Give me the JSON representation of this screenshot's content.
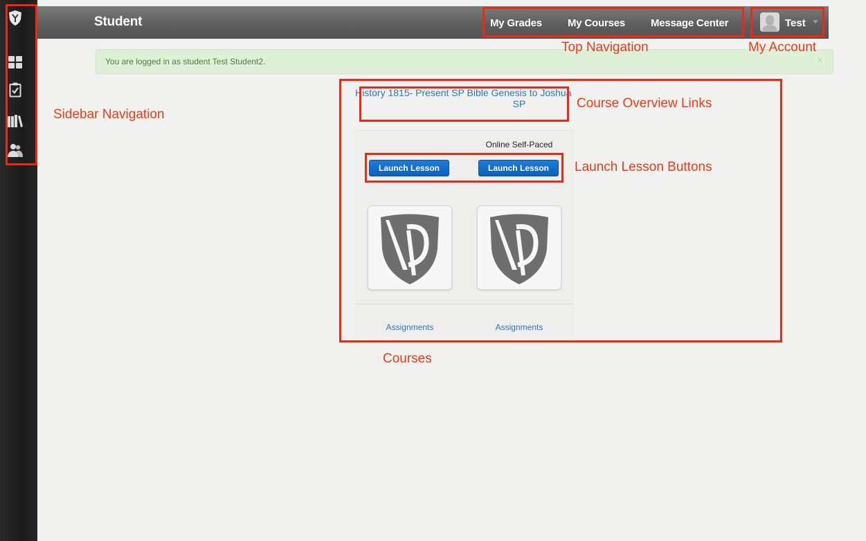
{
  "header": {
    "brand": "Student",
    "nav": [
      {
        "label": "My Grades"
      },
      {
        "label": "My Courses"
      },
      {
        "label": "Message Center"
      }
    ],
    "user": {
      "name": "Test"
    }
  },
  "sidebar": {
    "icons": [
      "school-crest-icon",
      "dashboard-icon",
      "checklist-icon",
      "books-icon",
      "people-icon"
    ]
  },
  "alert": {
    "message": "You are logged in as student Test Student2.",
    "close": "×"
  },
  "courses": [
    {
      "title": "History 1815- Present SP",
      "type": "",
      "launch": "Launch Lesson",
      "assignments": "Assignments"
    },
    {
      "title": "Bible Genesis to Joshua SP",
      "type": "Online Self-Paced",
      "launch": "Launch Lesson",
      "assignments": "Assignments"
    }
  ],
  "annotations": {
    "top_navigation": "Top Navigation",
    "my_account": "My Account",
    "sidebar_navigation": "Sidebar Navigation",
    "course_overview_links": "Course Overview Links",
    "launch_lesson_buttons": "Launch Lesson Buttons",
    "courses": "Courses"
  },
  "colors": {
    "annotation": "#ec2a12",
    "link": "#2a76bb",
    "button": "#0b5fbf",
    "alert_bg": "#dff0d8"
  }
}
